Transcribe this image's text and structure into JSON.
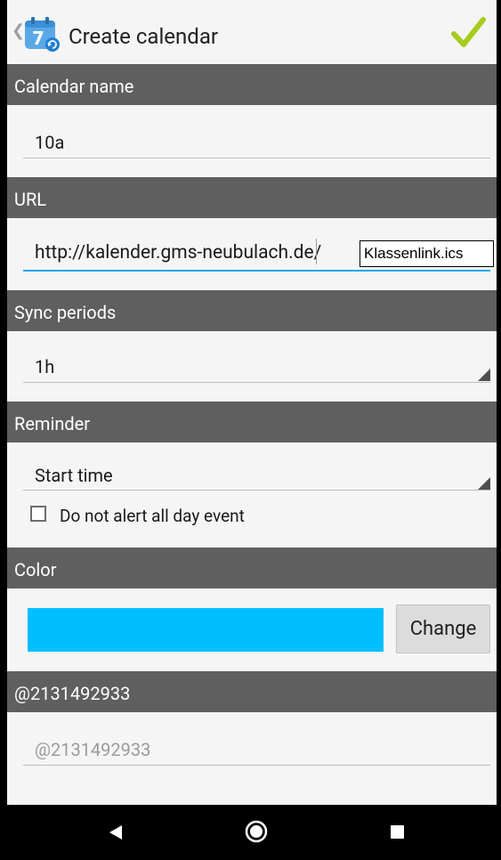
{
  "actionbar": {
    "title": "Create calendar",
    "up_icon": "chevron-left-icon",
    "app_icon_number": "7",
    "confirm_icon": "check-icon",
    "confirm_color": "#a6cc1e"
  },
  "sections": {
    "calendar_name": {
      "header": "Calendar name",
      "value": "10a"
    },
    "url": {
      "header": "URL",
      "value": "http://kalender.gms-neubulach.de/",
      "tooltip": "Klassenlink.ics"
    },
    "sync": {
      "header": "Sync periods",
      "value": "1h"
    },
    "reminder": {
      "header": "Reminder",
      "value": "Start time",
      "checkbox_label": "Do not alert all day event",
      "checkbox_checked": false
    },
    "color": {
      "header": "Color",
      "swatch_color": "#00bfff",
      "button_label": "Change"
    },
    "extra": {
      "header": "@2131492933",
      "placeholder": "@2131492933"
    }
  },
  "navbar": {
    "back_icon": "back-triangle-icon",
    "home_icon": "home-circle-icon",
    "recents_icon": "recents-square-icon"
  }
}
